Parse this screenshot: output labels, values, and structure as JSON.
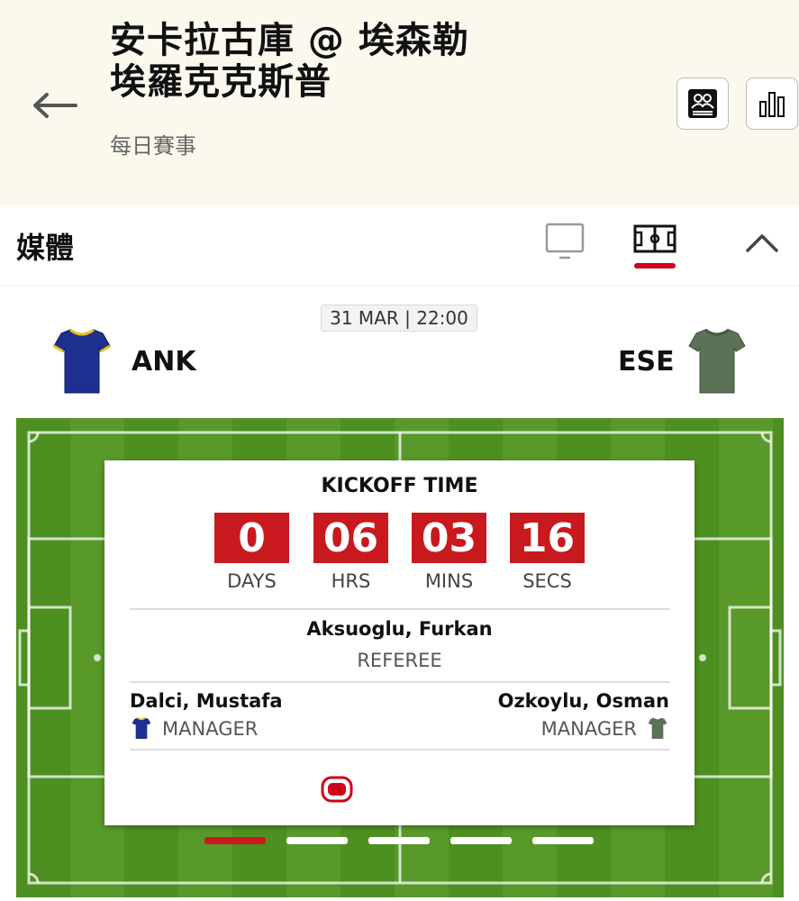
{
  "header": {
    "title_line1": "安卡拉古庫 @ 埃森勒",
    "title_line2": "埃羅克克斯普",
    "subtitle": "每日賽事",
    "back_icon": "back-arrow-icon",
    "lineup_icon": "lineup-icon",
    "stats_icon": "stats-bar-chart-icon"
  },
  "media": {
    "title": "媒體",
    "tv_icon": "tv-icon",
    "pitch_icon": "pitch-icon",
    "collapse_icon": "chevron-up-icon"
  },
  "match": {
    "datetime": "31 MAR | 22:00",
    "home_code": "ANK",
    "away_code": "ESE",
    "home_color": "#1f2f8f",
    "home_trim": "#e6c21a",
    "away_color": "#5c7257"
  },
  "card": {
    "title": "KICKOFF TIME",
    "countdown": [
      {
        "value": "0",
        "label": "DAYS"
      },
      {
        "value": "06",
        "label": "HRS"
      },
      {
        "value": "03",
        "label": "MINS"
      },
      {
        "value": "16",
        "label": "SECS"
      }
    ],
    "referee_name": "Aksuoglu, Furkan",
    "referee_role": "REFEREE",
    "home_manager": "Dalci, Mustafa",
    "away_manager": "Ozkoylu, Osman",
    "manager_role": "MANAGER",
    "accent": "#c8191f"
  },
  "pager": {
    "count": 5,
    "active_index": 0
  }
}
